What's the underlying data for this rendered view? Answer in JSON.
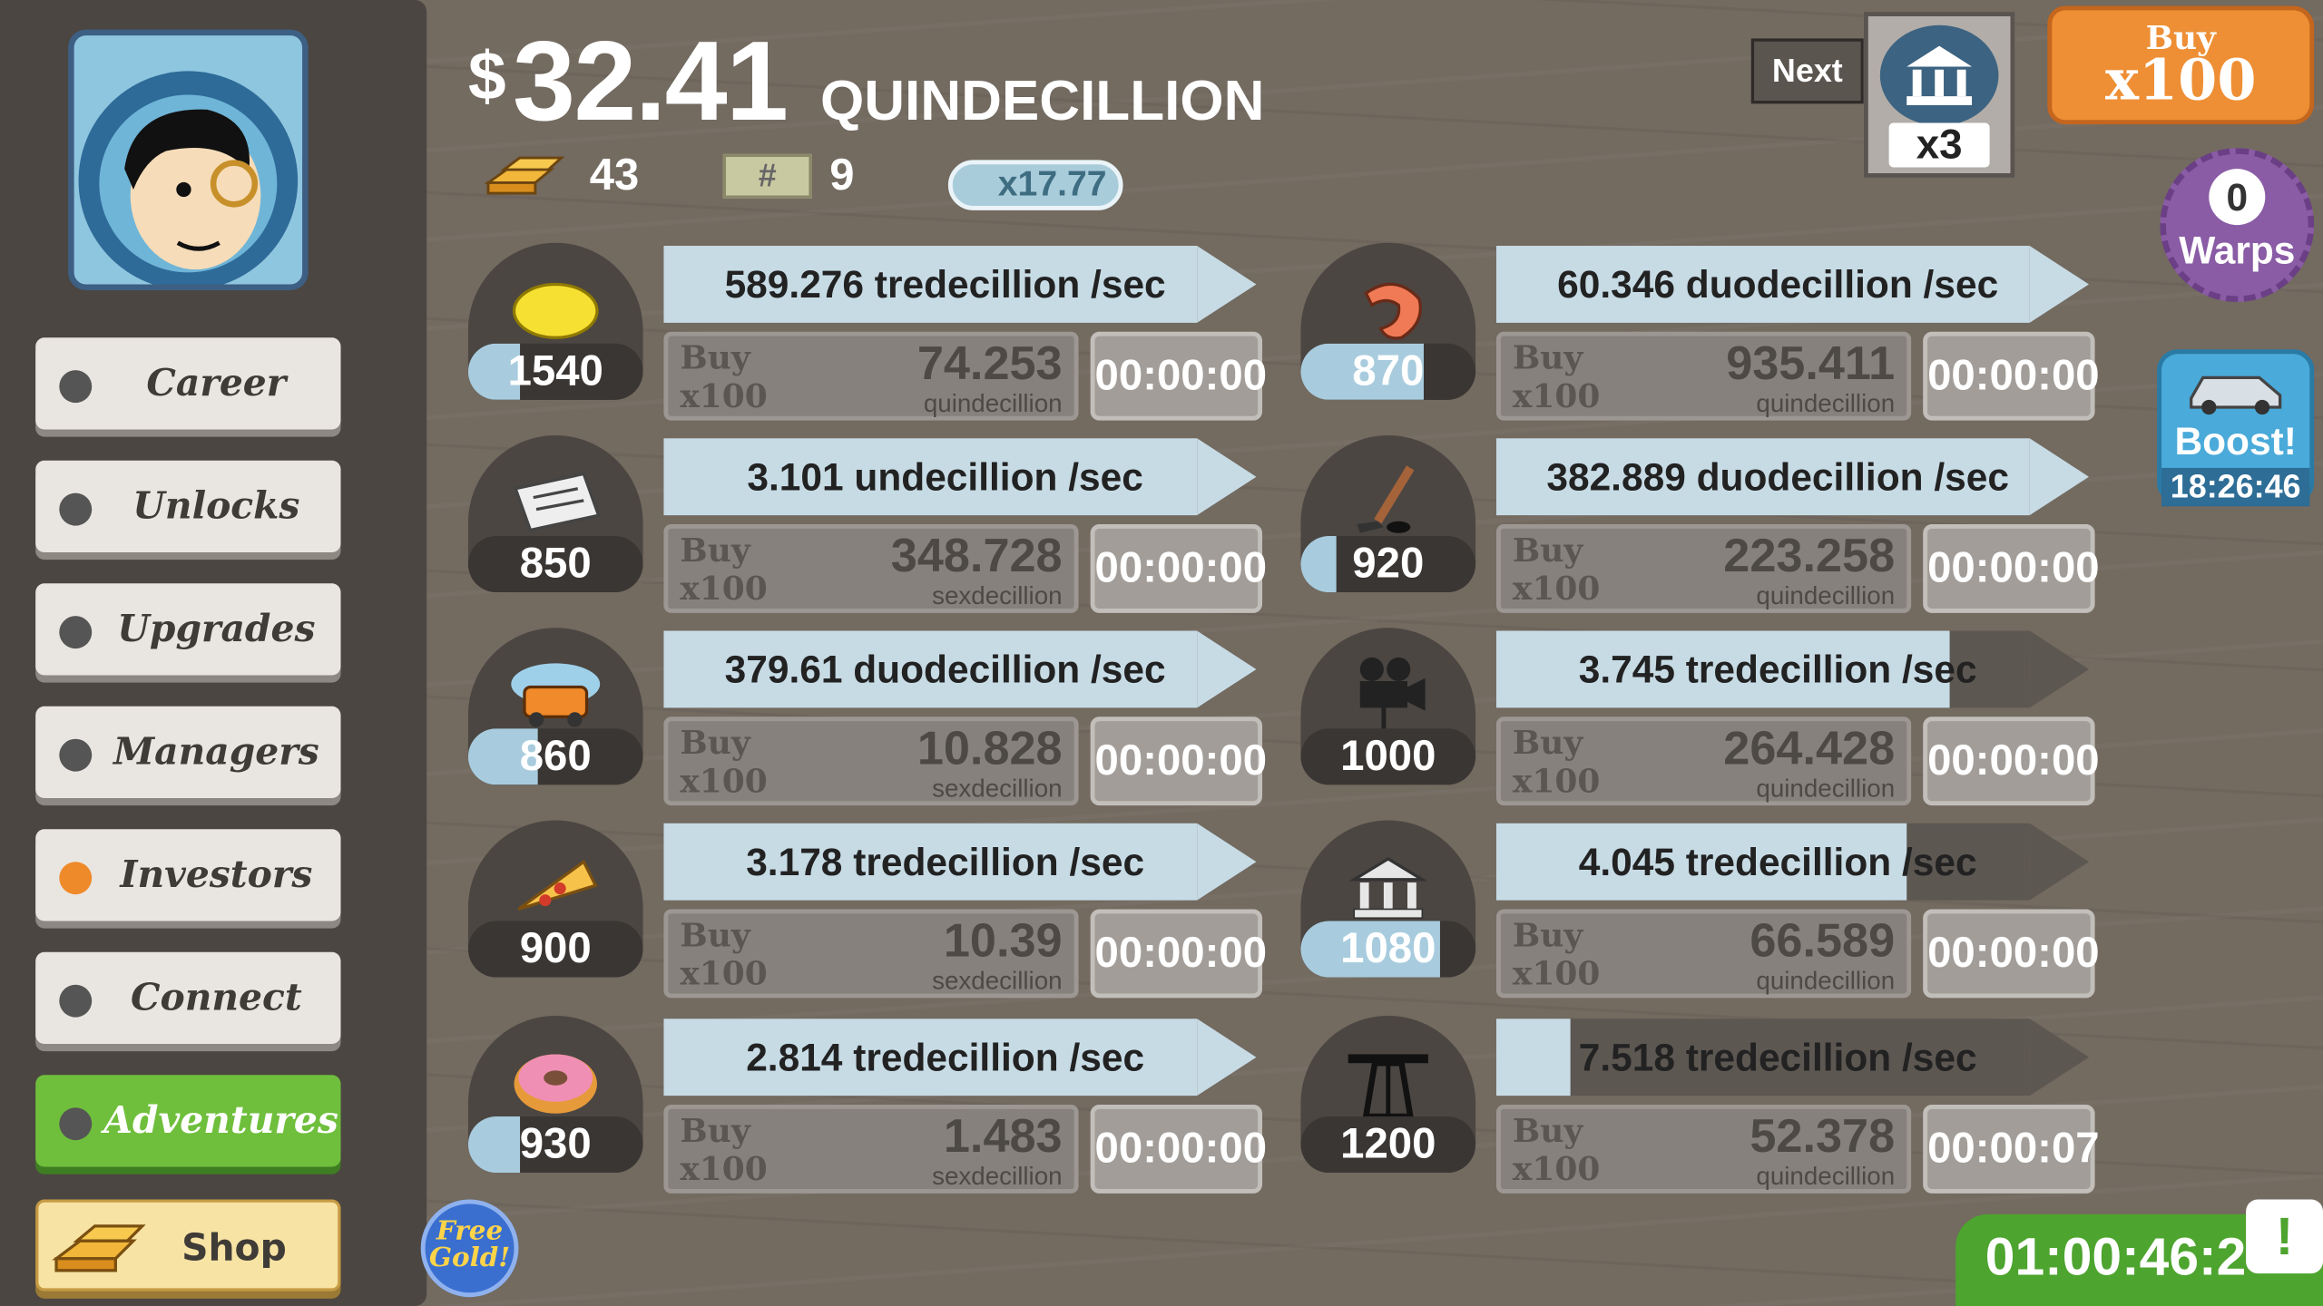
{
  "header": {
    "currency_symbol": "$",
    "money_amount": "32.41",
    "money_unit": "QUINDECILLION",
    "gold_bars": "43",
    "angel_count": "9",
    "angel_multiplier": "x17.77"
  },
  "sidebar": {
    "items": [
      {
        "label": "Career"
      },
      {
        "label": "Unlocks"
      },
      {
        "label": "Upgrades"
      },
      {
        "label": "Managers"
      },
      {
        "label": "Investors",
        "indicator": "#ef8a2a"
      },
      {
        "label": "Connect"
      },
      {
        "label": "Adventures"
      },
      {
        "label": "Shop"
      }
    ]
  },
  "next_unlock": {
    "label": "Next",
    "multiplier": "x3",
    "icon": "bank-icon"
  },
  "buy_mode": {
    "label": "Buy",
    "amount": "x100"
  },
  "warps": {
    "count": "0",
    "label": "Warps"
  },
  "boost": {
    "label": "Boost!",
    "timer": "18:26:46"
  },
  "free_gold": {
    "label_line1": "Free",
    "label_line2": "Gold!"
  },
  "tv_timer": {
    "time": "01:00:46:2",
    "icon": "tv-alert-icon",
    "badge": "!"
  },
  "businesses": [
    {
      "icon": "lemon-icon",
      "owned": "1540",
      "owned_progress": 0.3,
      "rate": "589.276 tredecillion /sec",
      "rate_progress": 1.0,
      "buy_word": "Buy",
      "buy_amount": "x100",
      "cost": "74.253",
      "cost_unit": "quindecillion",
      "timer": "00:00:00"
    },
    {
      "icon": "newspaper-icon",
      "owned": "850",
      "owned_progress": 0.0,
      "rate": "3.101 undecillion /sec",
      "rate_progress": 1.0,
      "buy_word": "Buy",
      "buy_amount": "x100",
      "cost": "348.728",
      "cost_unit": "sexdecillion",
      "timer": "00:00:00"
    },
    {
      "icon": "car-wash-icon",
      "owned": "860",
      "owned_progress": 0.4,
      "rate": "379.61 duodecillion /sec",
      "rate_progress": 1.0,
      "buy_word": "Buy",
      "buy_amount": "x100",
      "cost": "10.828",
      "cost_unit": "sexdecillion",
      "timer": "00:00:00"
    },
    {
      "icon": "pizza-icon",
      "owned": "900",
      "owned_progress": 0.0,
      "rate": "3.178 tredecillion /sec",
      "rate_progress": 1.0,
      "buy_word": "Buy",
      "buy_amount": "x100",
      "cost": "10.39",
      "cost_unit": "sexdecillion",
      "timer": "00:00:00"
    },
    {
      "icon": "donut-icon",
      "owned": "930",
      "owned_progress": 0.3,
      "rate": "2.814 tredecillion /sec",
      "rate_progress": 1.0,
      "buy_word": "Buy",
      "buy_amount": "x100",
      "cost": "1.483",
      "cost_unit": "sexdecillion",
      "timer": "00:00:00"
    },
    {
      "icon": "shrimp-icon",
      "owned": "870",
      "owned_progress": 0.7,
      "rate": "60.346 duodecillion /sec",
      "rate_progress": 1.0,
      "buy_word": "Buy",
      "buy_amount": "x100",
      "cost": "935.411",
      "cost_unit": "quindecillion",
      "timer": "00:00:00"
    },
    {
      "icon": "hockey-icon",
      "owned": "920",
      "owned_progress": 0.2,
      "rate": "382.889 duodecillion /sec",
      "rate_progress": 1.0,
      "buy_word": "Buy",
      "buy_amount": "x100",
      "cost": "223.258",
      "cost_unit": "quindecillion",
      "timer": "00:00:00"
    },
    {
      "icon": "movie-camera-icon",
      "owned": "1000",
      "owned_progress": 0.0,
      "rate": "3.745 tredecillion /sec",
      "rate_progress": 0.85,
      "buy_word": "Buy",
      "buy_amount": "x100",
      "cost": "264.428",
      "cost_unit": "quindecillion",
      "timer": "00:00:00"
    },
    {
      "icon": "bank-icon",
      "owned": "1080",
      "owned_progress": 0.8,
      "rate": "4.045 tredecillion /sec",
      "rate_progress": 0.77,
      "buy_word": "Buy",
      "buy_amount": "x100",
      "cost": "66.589",
      "cost_unit": "quindecillion",
      "timer": "00:00:00"
    },
    {
      "icon": "oil-rig-icon",
      "owned": "1200",
      "owned_progress": 0.0,
      "rate": "7.518 tredecillion /sec",
      "rate_progress": 0.14,
      "buy_word": "Buy",
      "buy_amount": "x100",
      "cost": "52.378",
      "cost_unit": "quindecillion",
      "timer": "00:00:07"
    }
  ]
}
